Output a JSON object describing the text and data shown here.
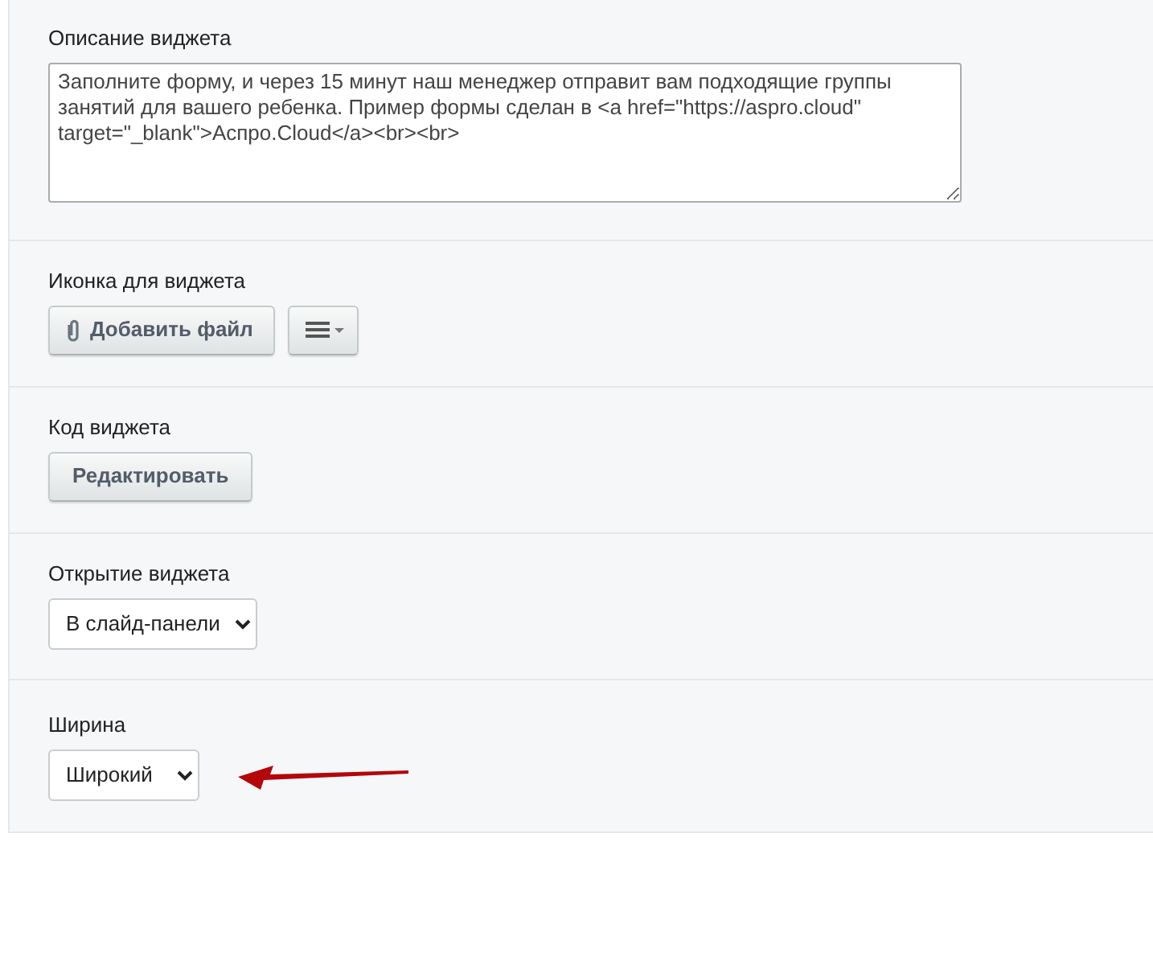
{
  "sections": [
    {
      "kind": "textarea",
      "label": "Описание виджета",
      "value": "Заполните форму, и через 15 минут наш менеджер отправит вам подходящие группы занятий для вашего ребенка. Пример формы сделан в <a href=\"https://aspro.cloud\" target=\"_blank\">Аспро.Cloud</a><br><br>"
    },
    {
      "kind": "file",
      "label": "Иконка для виджета",
      "button": "Добавить файл"
    },
    {
      "kind": "button",
      "label": "Код виджета",
      "button": "Редактировать"
    },
    {
      "kind": "select",
      "label": "Открытие виджета",
      "value": "В слайд-панели"
    },
    {
      "kind": "select",
      "label": "Ширина",
      "value": "Широкий",
      "arrow": true
    }
  ]
}
